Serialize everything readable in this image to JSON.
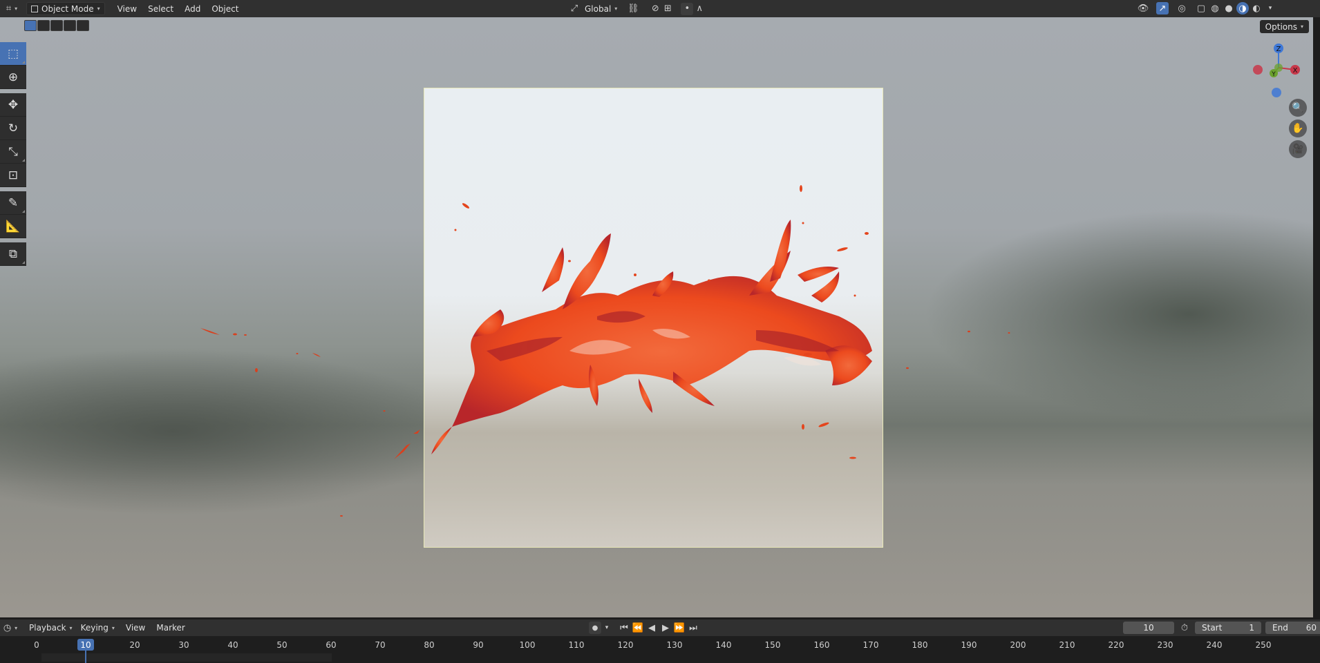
{
  "header": {
    "mode_label": "Object Mode",
    "menus": [
      "View",
      "Select",
      "Add",
      "Object"
    ],
    "transform_orientation": "Global"
  },
  "viewport": {
    "options_label": "Options",
    "gizmo": {
      "z": "Z",
      "y": "Y",
      "x": "X"
    },
    "colors": {
      "x_axis": "#c8384a",
      "y_axis": "#6ba12f",
      "z_axis": "#3f78d6",
      "selection": "#4772b3",
      "splash": "#e8431c"
    }
  },
  "toolbar": {
    "tools": [
      "select-box",
      "cursor",
      "move",
      "rotate",
      "scale",
      "transform",
      "annotate",
      "measure",
      "add-cube"
    ],
    "active": "select-box"
  },
  "timeline": {
    "menus": [
      "Playback",
      "Keying",
      "View",
      "Marker"
    ],
    "current_frame": "10",
    "start_label": "Start",
    "start_value": "1",
    "end_label": "End",
    "end_value": "60",
    "ticks": [
      "0",
      "10",
      "20",
      "30",
      "40",
      "50",
      "60",
      "70",
      "80",
      "90",
      "100",
      "110",
      "120",
      "130",
      "140",
      "150",
      "160",
      "170",
      "180",
      "190",
      "200",
      "210",
      "220",
      "230",
      "240",
      "250"
    ]
  }
}
